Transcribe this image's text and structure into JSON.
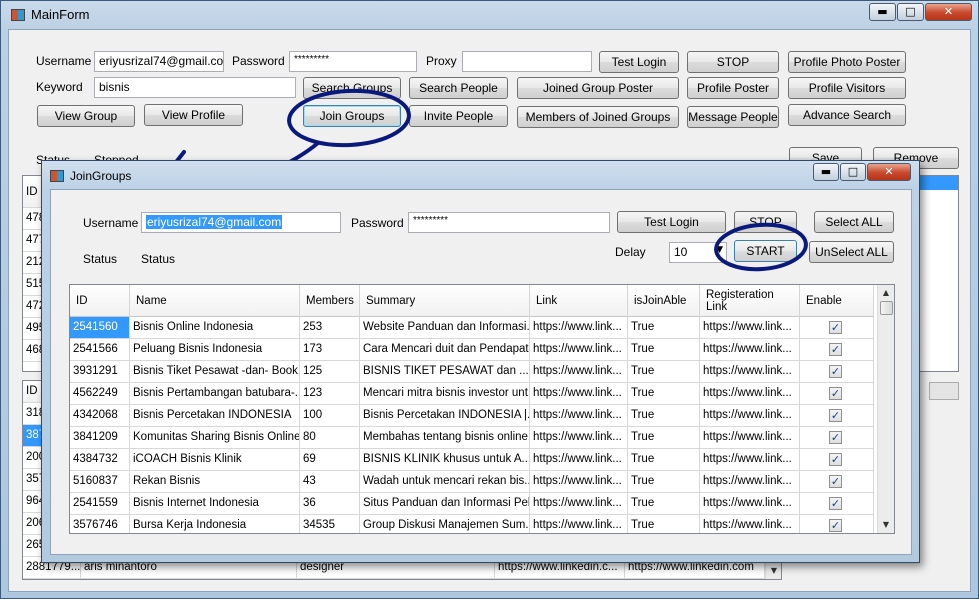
{
  "main_window": {
    "title": "MainForm",
    "username_label": "Username",
    "username_value": "eriyusrizal74@gmail.com",
    "password_label": "Password",
    "password_value": "*********",
    "proxy_label": "Proxy",
    "proxy_value": "",
    "keyword_label": "Keyword",
    "keyword_value": "bisnis",
    "buttons": {
      "test_login": "Test Login",
      "stop": "STOP",
      "profile_photo_poster": "Profile Photo Poster",
      "search_groups": "Search Groups",
      "search_people": "Search People",
      "joined_group_poster": "Joined Group Poster",
      "profile_poster": "Profile Poster",
      "profile_visitors": "Profile Visitors",
      "view_group": "View Group",
      "view_profile": "View Profile",
      "join_groups": "Join Groups",
      "invite_people": "Invite People",
      "members_of_joined_groups": "Members of Joined Groups",
      "message_people": "Message People",
      "advance_search": "Advance Search",
      "save": "Save",
      "remove": "Remove"
    },
    "status_label": "Status",
    "status_value": "Stopped",
    "upper_grid_header": "ID",
    "upper_grid_ids": [
      "478",
      "477",
      "212",
      "515",
      "472",
      "495",
      "468"
    ],
    "lower_grid_header": "ID",
    "lower_grid_ids": [
      "318",
      "387",
      "200",
      "357",
      "964",
      "206",
      "265"
    ],
    "bottom_row": {
      "id": "2881779...",
      "name": "aris minantoro",
      "title": "designer",
      "link1": "https://www.linkedin.c...",
      "link2": "https://www.linkedin.com"
    }
  },
  "join_dialog": {
    "title": "JoinGroups",
    "username_label": "Username",
    "username_value": "eriyusrizal74@gmail.com",
    "password_label": "Password",
    "password_value": "*********",
    "status_label": "Status",
    "status_value": "Status",
    "delay_label": "Delay",
    "delay_value": "10",
    "buttons": {
      "test_login": "Test Login",
      "stop": "STOP",
      "select_all": "Select ALL",
      "start": "START",
      "unselect_all": "UnSelect ALL"
    },
    "columns": [
      "ID",
      "Name",
      "Members",
      "Summary",
      "Link",
      "isJoinAble",
      "Registeration Link",
      "Enable"
    ],
    "rows": [
      {
        "id": "2541560",
        "name": "Bisnis Online Indonesia",
        "members": "253",
        "summary": "Website Panduan dan Informasi...",
        "link": "https://www.link...",
        "joinable": "True",
        "reg_link": "https://www.link...",
        "enable": "✓"
      },
      {
        "id": "2541566",
        "name": "Peluang Bisnis Indonesia",
        "members": "173",
        "summary": "Cara Mencari duit dan Pendapat...",
        "link": "https://www.link...",
        "joinable": "True",
        "reg_link": "https://www.link...",
        "enable": "✓"
      },
      {
        "id": "3931291",
        "name": "Bisnis Tiket Pesawat -dan- Book...",
        "members": "125",
        "summary": "BISNIS TIKET PESAWAT dan ...",
        "link": "https://www.link...",
        "joinable": "True",
        "reg_link": "https://www.link...",
        "enable": "✓"
      },
      {
        "id": "4562249",
        "name": "Bisnis Pertambangan batubara-...",
        "members": "123",
        "summary": "Mencari mitra bisnis investor unt...",
        "link": "https://www.link...",
        "joinable": "True",
        "reg_link": "https://www.link...",
        "enable": "✓"
      },
      {
        "id": "4342068",
        "name": "Bisnis Percetakan INDONESIA",
        "members": "100",
        "summary": "Bisnis Percetakan INDONESIA |...",
        "link": "https://www.link...",
        "joinable": "True",
        "reg_link": "https://www.link...",
        "enable": "✓"
      },
      {
        "id": "3841209",
        "name": "Komunitas Sharing Bisnis Online",
        "members": "80",
        "summary": "Membahas tentang bisnis online...",
        "link": "https://www.link...",
        "joinable": "True",
        "reg_link": "https://www.link...",
        "enable": "✓"
      },
      {
        "id": "4384732",
        "name": "iCOACH Bisnis Klinik",
        "members": "69",
        "summary": "BISNIS KLINIK khusus untuk A...",
        "link": "https://www.link...",
        "joinable": "True",
        "reg_link": "https://www.link...",
        "enable": "✓"
      },
      {
        "id": "5160837",
        "name": "Rekan Bisnis",
        "members": "43",
        "summary": "Wadah untuk mencari rekan bis...",
        "link": "https://www.link...",
        "joinable": "True",
        "reg_link": "https://www.link...",
        "enable": "✓"
      },
      {
        "id": "2541559",
        "name": "Bisnis Internet Indonesia",
        "members": "36",
        "summary": "Situs Panduan dan Informasi Pel...",
        "link": "https://www.link...",
        "joinable": "True",
        "reg_link": "https://www.link...",
        "enable": "✓"
      },
      {
        "id": "3576746",
        "name": "Bursa Kerja Indonesia",
        "members": "34535",
        "summary": "Group Diskusi Manajemen Sum...",
        "link": "https://www.link...",
        "joinable": "True",
        "reg_link": "https://www.link...",
        "enable": "✓"
      }
    ]
  },
  "annotation_color": "#0a1a7c"
}
